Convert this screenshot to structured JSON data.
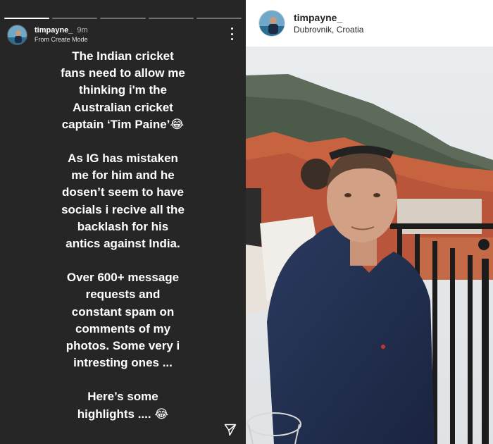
{
  "story": {
    "username": "timpayne_",
    "time": "9m",
    "subtitle": "From Create Mode",
    "progress_segments": 5,
    "active_segment": 1,
    "paragraphs": [
      [
        "The Indian cricket",
        "fans need to allow me",
        "thinking i'm the",
        "Australian cricket",
        "captain ‘Tim Paine’😂"
      ],
      [
        "As IG has mistaken",
        "me for him and he",
        "dosen’t seem to have",
        "socials i recive all the",
        "backlash for his",
        "antics against India."
      ],
      [
        "Over 600+ message",
        "requests and",
        "constant spam on",
        "comments of my",
        "photos. Some very i",
        "intresting ones ..."
      ],
      [
        "Here’s some",
        "highlights .... 😂"
      ]
    ],
    "icons": {
      "menu": "more-vertical-icon",
      "send": "send-icon"
    }
  },
  "post": {
    "username": "timpayne_",
    "location": "Dubrovnik, Croatia"
  }
}
